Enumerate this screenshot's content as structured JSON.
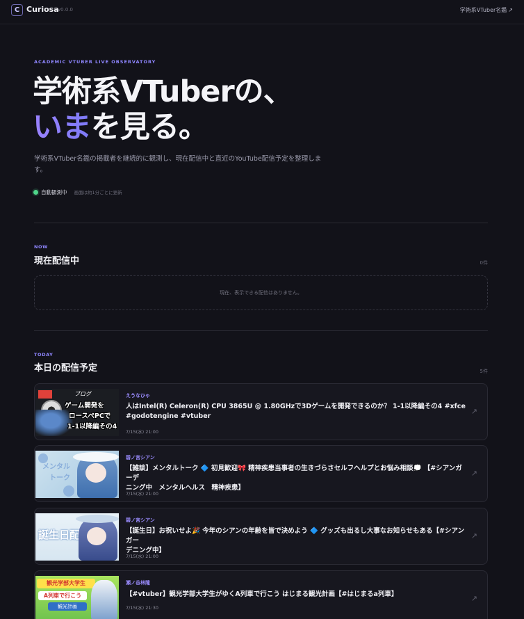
{
  "header": {
    "logo_letter": "C",
    "app_name": "Curiosa",
    "version": "v0.0.0",
    "link_label": "学術系VTuber名鑑",
    "link_icon": "↗"
  },
  "hero": {
    "eyebrow": "ACADEMIC VTUBER LIVE OBSERVATORY",
    "line1": "学術系VTuberの、",
    "line2_accent": "いま",
    "line2_rest": "を見る。",
    "description": "学術系VTuber名鑑の掲載者を継続的に観測し、現在配信中と直近のYouTube配信予定を整理します。",
    "status_label": "自動観測中",
    "status_note": "画面は約1分ごとに更新"
  },
  "now": {
    "tag": "NOW",
    "title": "現在配信中",
    "count": "0件",
    "empty_message": "現在、表示できる配信はありません。"
  },
  "today": {
    "tag": "TODAY",
    "title": "本日の配信予定",
    "count": "5件",
    "items": [
      {
        "channel": "えうなひゃ",
        "title_line1": "人はIntel(R) Celeron(R) CPU 3865U @ 1.80GHzで3Dゲームを開発できるのか？ 1-1以降編その4 #xfce",
        "title_line2": "#godotengine #vtuber",
        "time": "7/15(水) 21:00",
        "thumb_text": [
          "ゲーム開発を",
          "ロースペPCで",
          "1-1以降編その4"
        ],
        "thumb_label": "ブログ"
      },
      {
        "channel": "碧ノ宮シアン",
        "title_line1": "【雑談】メンタルトーク 🔷 初見歓迎🎀 精神疾患当事者の生きづらさセルフヘルプとお悩み相談💭 【#シアンガーデ",
        "title_line2": "ニング中　メンタルヘルス　精神疾患】",
        "time": "7/15(水) 21:00",
        "thumb_text": [
          "メンタル",
          "トーク"
        ]
      },
      {
        "channel": "碧ノ宮シアン",
        "title_line1": "【誕生日】お祝いせよ🎉 今年のシアンの年齢を皆で決めよう 🔷 グッズも出るし大事なお知らせもある【#シアンガー",
        "title_line2": "デニング中】",
        "time": "7/15(水) 21:00",
        "thumb_text": [
          "誕生日配信"
        ]
      },
      {
        "channel": "瀬ノ谷林隆",
        "title_line1": "【#vtuber】観光学部大学生がゆくA列車で行こう はじまる観光計画【#はじまるa列車】",
        "title_line2": "",
        "time": "7/15(水) 21:30",
        "thumb_text": [
          "観光学部大学生",
          "A列車で行こう",
          "観光計画"
        ]
      }
    ]
  },
  "colors": {
    "background": "#121219",
    "accent": "#8f86ff",
    "status_green": "#4fd58a"
  },
  "icons": {
    "external": "external-link-icon",
    "status": "status-dot-icon"
  }
}
